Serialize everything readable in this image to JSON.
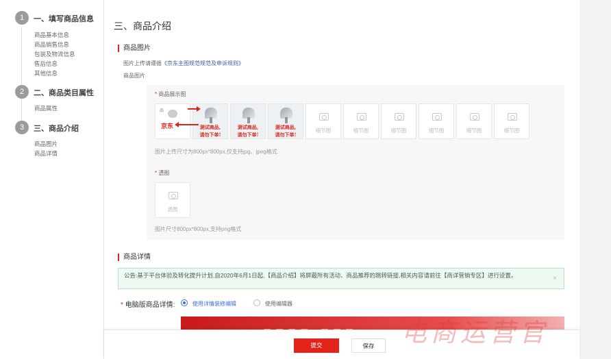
{
  "steps": [
    {
      "num": "1",
      "title": "一、填写商品信息",
      "items": [
        "商品基本信息",
        "商品销售信息",
        "包装及物流信息",
        "售后信息",
        "其他信息"
      ]
    },
    {
      "num": "2",
      "title": "二、商品类目属性",
      "items": [
        "商品属性"
      ]
    },
    {
      "num": "3",
      "title": "三、商品介绍",
      "items": [
        "商品图片",
        "商品详情"
      ]
    }
  ],
  "page_title": "三、商品介绍",
  "images_section": {
    "heading": "商品图片",
    "rule_prefix": "图片上传请遵循",
    "rule_link": "《京东主图规范规范及申诉规则》",
    "field_label": "商品图片",
    "display_label": "商品展示图",
    "req_mark": "*",
    "product_image_text": [
      "测试商品,",
      "请勿下单!"
    ],
    "first_image_logo": "京东",
    "empty_slot_label": "细节图",
    "display_hint": "图片上传尺寸为800px*800px,仅支持jpg、jpeg格式",
    "transparent_label": "透图",
    "transparent_slot_label": "透图",
    "transparent_hint": "图片尺寸800px*800px,支持png格式"
  },
  "detail_section": {
    "heading": "商品详情",
    "notice": "公告:基于平台体验及转化提升计划,自2020年6月1日起,【商品介绍】将屏蔽所有活动、商品推荐的跳转链接,相关内容请前往【商详营销专区】进行设置。",
    "notice_close": "×",
    "pc_detail_label": "电脑版商品详情:",
    "option_1": "使用详情装修编辑",
    "option_2": "使用编辑器"
  },
  "footer": {
    "submit": "提交",
    "save": "保存"
  },
  "watermark": "电商运营官",
  "colors": {
    "accent": "#e2231a",
    "radio": "#3a6fd8",
    "notice_bg": "#eefaf1"
  }
}
